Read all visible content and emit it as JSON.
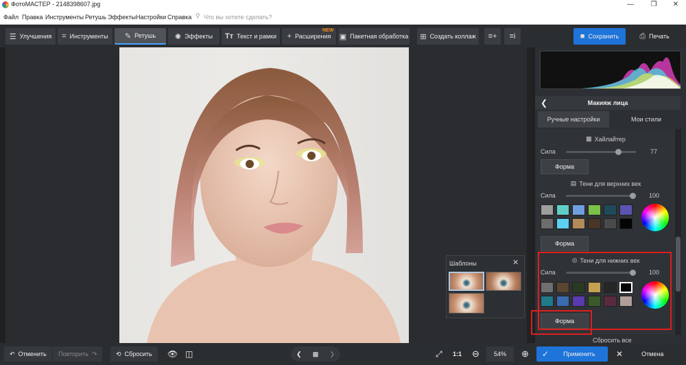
{
  "window": {
    "title": "ФотоМАСТЕР - 2148398607.jpg",
    "minimize": "—",
    "maximize": "❐",
    "close": "✕"
  },
  "menu": {
    "items": [
      "Файл",
      "Правка",
      "Инструменты",
      "Ретушь",
      "Эффекты",
      "Настройки",
      "Справка"
    ],
    "search_placeholder": "Что вы хотите сделать?"
  },
  "toolbar": {
    "tabs": [
      "Улучшения",
      "Инструменты",
      "Ретушь",
      "Эффекты",
      "Текст и рамки",
      "Расширения"
    ],
    "active": "Ретушь",
    "new_badge": "NEW",
    "batch": "Пакетная обработка",
    "collage": "Создать коллаж",
    "save": "Сохранить",
    "print": "Печать"
  },
  "panel": {
    "title": "Макияж лица",
    "tabs": [
      "Ручные настройки",
      "Мои стили"
    ],
    "highlighter": {
      "title": "Хайлайтер",
      "strength_label": "Сила",
      "strength": 77,
      "shape_button": "Форма"
    },
    "upper_shadows": {
      "title": "Тени для верхних век",
      "strength_label": "Сила",
      "strength": 100,
      "shape_button": "Форма",
      "swatches": [
        "#9e9e9e",
        "#5fcfc6",
        "#6f9fe0",
        "#7bc24a",
        "#1f4a5a",
        "#5a55b0",
        "#6d6d6d",
        "#5cd0f0",
        "#b58a5a",
        "#4a3626",
        "#4a4a4a",
        "#050505"
      ]
    },
    "lower_shadows": {
      "title": "Тени для нижних век",
      "strength_label": "Сила",
      "strength": 100,
      "shape_button": "Форма",
      "swatches": [
        "#6f6f6f",
        "#5a4630",
        "#2a3a22",
        "#c4a050",
        "#262626",
        "#050505",
        "#1f7a8a",
        "#3a6ab0",
        "#5a3ab0",
        "#3a5a2a",
        "#5a2a40",
        "#b0a098"
      ]
    },
    "reset_all": "Сбросить все"
  },
  "templates": {
    "title": "Шаблоны",
    "close": "✕"
  },
  "bottombar": {
    "undo": "Отменить",
    "redo": "Повторить",
    "reset": "Сбросить",
    "zoom_fit": "1:1",
    "zoom_level": "54%",
    "apply": "Применить",
    "cancel": "Отмена"
  },
  "colors": {
    "accent": "#1e74d9",
    "highlight_frame": "#e01e1e",
    "new_badge": "#ff8c1a"
  }
}
